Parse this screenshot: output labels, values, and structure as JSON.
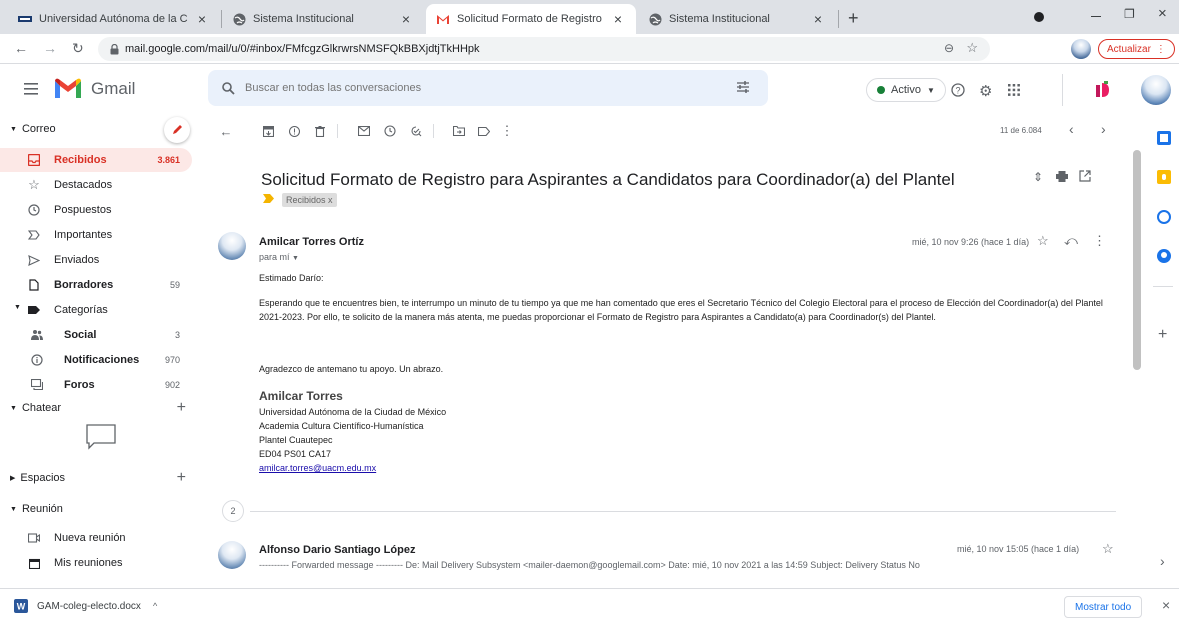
{
  "browser": {
    "tabs": [
      {
        "title": "Universidad Autónoma de la Ciu",
        "favicon": "uacm-logo-icon"
      },
      {
        "title": "Sistema Institucional",
        "favicon": "globe-icon"
      },
      {
        "title": "Solicitud Formato de Registro pa",
        "favicon": "gmail-icon",
        "active": true
      },
      {
        "title": "Sistema Institucional",
        "favicon": "globe-icon"
      }
    ],
    "url": "mail.google.com/mail/u/0/#inbox/FMfcgzGlkrwrsNMSFQkBBXjdtjTkHHpk",
    "update_label": "Actualizar"
  },
  "gmail": {
    "logo_text": "Gmail",
    "search_placeholder": "Buscar en todas las conversaciones",
    "status_label": "Activo"
  },
  "sidebar": {
    "sections": {
      "mail": "Correo",
      "chat": "Chatear",
      "spaces": "Espacios",
      "meet": "Reunión"
    },
    "items": [
      {
        "label": "Recibidos",
        "count": "3.861",
        "icon": "inbox-icon"
      },
      {
        "label": "Destacados",
        "count": "",
        "icon": "star-icon"
      },
      {
        "label": "Pospuestos",
        "count": "",
        "icon": "clock-icon"
      },
      {
        "label": "Importantes",
        "count": "",
        "icon": "important-icon"
      },
      {
        "label": "Enviados",
        "count": "",
        "icon": "send-icon"
      },
      {
        "label": "Borradores",
        "count": "59",
        "icon": "draft-icon"
      },
      {
        "label": "Categorías",
        "count": "",
        "icon": "label-icon"
      },
      {
        "label": "Social",
        "count": "3",
        "icon": "people-icon"
      },
      {
        "label": "Notificaciones",
        "count": "970",
        "icon": "info-icon"
      },
      {
        "label": "Foros",
        "count": "902",
        "icon": "forum-icon"
      }
    ],
    "meet_items": [
      {
        "label": "Nueva reunión",
        "icon": "video-icon"
      },
      {
        "label": "Mis reuniones",
        "icon": "calendar-icon"
      }
    ]
  },
  "toolbar": {
    "pagination": "11 de 6.084"
  },
  "thread": {
    "subject": "Solicitud Formato de Registro para Aspirantes a Candidatos para Coordinador(a) del Plantel",
    "label_chip": "Recibidos x",
    "collapsed_count": "2",
    "messages": [
      {
        "sender": "Amilcar Torres Ortíz",
        "to": "para mí",
        "date": "mié, 10 nov 9:26 (hace 1 día)",
        "greeting": "Estimado Darío:",
        "paragraph": "Esperando que te encuentres bien, te interrumpo un minuto de tu tiempo ya que me han comentado que eres el Secretario Técnico del Colegio Electoral para el proceso de Elección del Coordinador(a) del Plantel 2021-2023. Por ello, te solicito de la manera más atenta, me puedas proporcionar el Formato de Registro para Aspirantes a Candidato(a) para Coordinador(s) del Plantel.",
        "closing": "Agradezco de antemano tu apoyo. Un abrazo.",
        "signature": {
          "name": "Amilcar Torres",
          "lines": [
            "Universidad Autónoma de la Ciudad de México",
            "Academia Cultura Científico-Humanística",
            "Plantel Cuautepec",
            "ED04 PS01 CA17"
          ],
          "email": "amilcar.torres@uacm.edu.mx"
        }
      },
      {
        "sender": "Alfonso Dario Santiago López",
        "date": "mié, 10 nov 15:05 (hace 1 día)",
        "snippet": "---------- Forwarded message --------- De: Mail Delivery Subsystem <mailer-daemon@googlemail.com> Date: mié, 10 nov 2021 a las 14:59 Subject: Delivery Status No"
      }
    ]
  },
  "downloads": {
    "file_name": "GAM-coleg-electo.docx",
    "show_all_label": "Mostrar todo"
  },
  "colors": {
    "gmail_red": "#d93025",
    "selected_bg": "#fce8e6",
    "search_bg": "#eaf1fb",
    "active_green": "#188038"
  }
}
